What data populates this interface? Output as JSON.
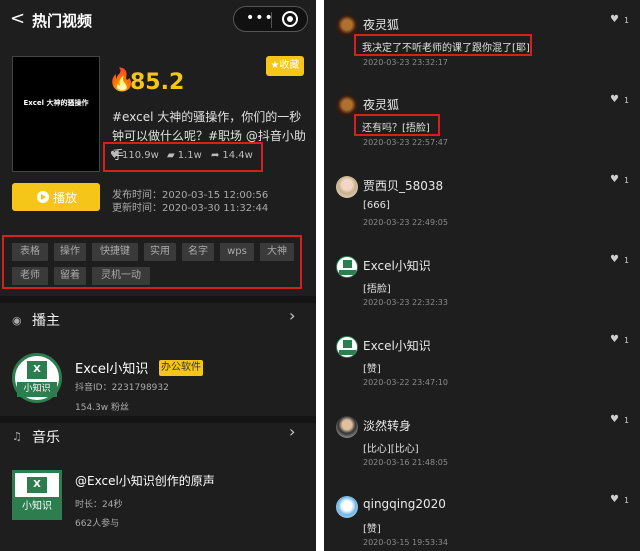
{
  "header": {
    "back": "<",
    "title": "热门视频",
    "more": "•••"
  },
  "video": {
    "cover_text": "Excel 大神的骚操作",
    "heat": "85.2",
    "favorite": "★收藏",
    "description": "#excel 大神的骚操作，你们的一秒钟可以做什么呢？#职场 @抖音小助手",
    "likes": "110.9w",
    "comments": "1.1w",
    "shares": "14.4w",
    "play_label": "播放",
    "publish_time": "发布时间：2020-03-15 12:00:56",
    "update_time": "更新时间：2020-03-30 11:32:44",
    "tags": [
      "表格",
      "操作",
      "快捷键",
      "实用",
      "名字",
      "wps",
      "大神",
      "老师",
      "留着",
      "灵机一动"
    ]
  },
  "creator": {
    "section_title": "播主",
    "name": "Excel小知识",
    "badge": "办公软件",
    "douyin_id": "抖音ID：2231798932",
    "fans": "154.3w 粉丝",
    "logo_x": "X",
    "logo_label": "小知识"
  },
  "music": {
    "section_title": "音乐",
    "title": "@Excel小知识创作的原声",
    "duration": "时长：24秒",
    "participants": "662人参与",
    "logo_x": "X",
    "logo_label": "小知识"
  },
  "comments": [
    {
      "user": "夜灵狐",
      "text": "我决定了不听老师的课了跟你混了[耶]",
      "time": "2020-03-23 23:32:17",
      "likes": "1",
      "avatar": "fox"
    },
    {
      "user": "夜灵狐",
      "text": "还有吗？[捂脸]",
      "time": "2020-03-23 22:57:47",
      "likes": "1",
      "avatar": "fox"
    },
    {
      "user": "贾西贝_58038",
      "text": "[666]",
      "time": "2020-03-23 22:49:05",
      "likes": "1",
      "avatar": "girl"
    },
    {
      "user": "Excel小知识",
      "text": "[捂脸]",
      "time": "2020-03-23 22:32:33",
      "likes": "1",
      "avatar": "excel"
    },
    {
      "user": "Excel小知识",
      "text": "[赞]",
      "time": "2020-03-22 23:47:10",
      "likes": "1",
      "avatar": "excel"
    },
    {
      "user": "淡然转身",
      "text": "[比心][比心]",
      "time": "2020-03-16 21:48:05",
      "likes": "1",
      "avatar": "man"
    },
    {
      "user": "qingqing2020",
      "text": "[赞]",
      "time": "2020-03-15 19:53:34",
      "likes": "1",
      "avatar": "cartoon"
    }
  ],
  "icons": {
    "heart": "♥",
    "fire": "🔥",
    "chevron": "›"
  },
  "colors": {
    "accent": "#f5c518",
    "highlight": "#d62020",
    "background": "#1e1e1e",
    "excel_green": "#2e7d4f"
  }
}
